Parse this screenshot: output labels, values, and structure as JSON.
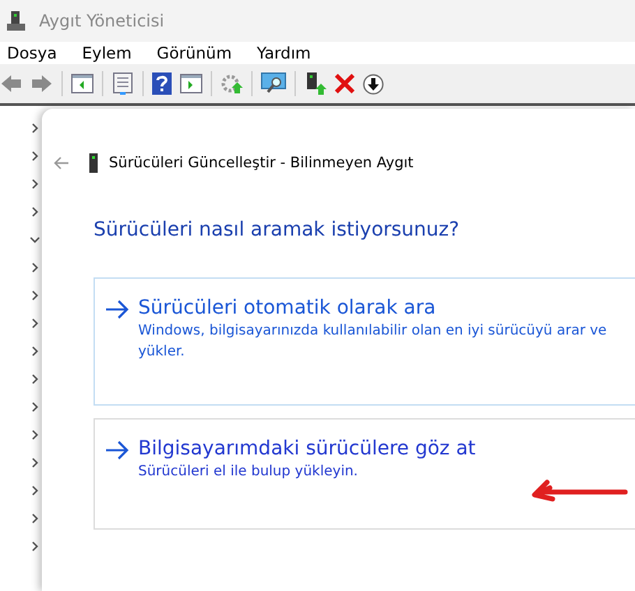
{
  "window": {
    "title": "Aygıt Yöneticisi"
  },
  "menu": [
    "Dosya",
    "Eylem",
    "Görünüm",
    "Yardım"
  ],
  "tree": [
    {
      "expanded": false
    },
    {
      "expanded": false
    },
    {
      "expanded": false
    },
    {
      "expanded": false
    },
    {
      "expanded": true
    },
    {
      "expanded": false
    },
    {
      "expanded": false
    },
    {
      "expanded": false
    },
    {
      "expanded": false
    },
    {
      "expanded": false
    },
    {
      "expanded": false
    },
    {
      "expanded": false
    },
    {
      "expanded": false
    },
    {
      "expanded": false
    },
    {
      "expanded": false
    },
    {
      "expanded": false
    }
  ],
  "dialog": {
    "title": "Sürücüleri Güncelleştir - Bilinmeyen Aygıt",
    "heading": "Sürücüleri nasıl aramak istiyorsunuz?",
    "options": [
      {
        "title": "Sürücüleri otomatik olarak ara",
        "description_lines": [
          "Windows, bilgisayarınızda kullanılabilir olan en iyi sürücüyü arar ve",
          "yükler."
        ],
        "highlighted": true
      },
      {
        "title": "Bilgisayarımdaki sürücülere göz at",
        "description_lines": [
          "Sürücüleri el ile bulup yükleyin."
        ],
        "highlighted": false
      }
    ]
  }
}
